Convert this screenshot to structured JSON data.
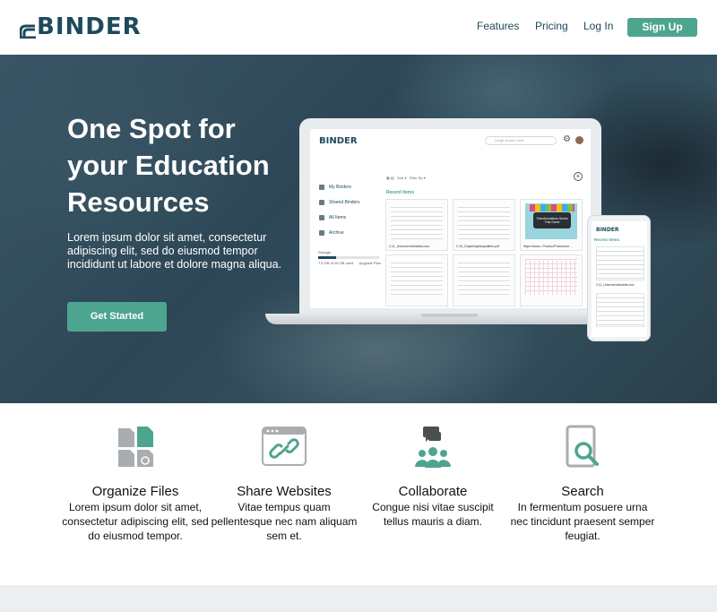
{
  "nav": {
    "logo_text": "BINDER",
    "links": [
      "Features",
      "Pricing",
      "Log In"
    ],
    "signup_label": "Sign Up"
  },
  "hero": {
    "title": "One Spot for your Education Resources",
    "text": "Lorem ipsum dolor sit amet, consectetur adipiscing elit, sed do eiusmod tempor incididunt ut labore et dolore magna aliqua.",
    "cta_label": "Get Started"
  },
  "app_preview": {
    "logo_text": "BINDER",
    "search_placeholder": "Large search here",
    "sidebar": [
      "My Binders",
      "Shared Binders",
      "All Items",
      "Archive"
    ],
    "storage_label": "Storage",
    "storage_fraction": 0.3,
    "storage_text": "7.5 GB of 25 GB used",
    "upgrade_label": "Upgrade Plan",
    "toolbar_sort": "Sort",
    "toolbar_filter": "Filter By",
    "recent_label": "Recent Items",
    "cards": [
      {
        "caption": "2.11_UnknownVariables.doc",
        "type": "doc"
      },
      {
        "caption": "2.15_GraphingInequalities.pdf",
        "type": "doc"
      },
      {
        "caption": "https://www...Product/Transform...",
        "type": "game"
      },
      {
        "caption": "",
        "type": "doc"
      },
      {
        "caption": "",
        "type": "doc"
      },
      {
        "caption": "",
        "type": "graph"
      }
    ],
    "game_caption": "Transformations Guess That Game"
  },
  "phone_preview": {
    "logo_text": "BINDER",
    "recent_label": "Recent Items",
    "caption": "2.11_UnknownVariables.doc"
  },
  "features": [
    {
      "icon": "files-icon",
      "title": "Organize Files",
      "text": "Lorem ipsum dolor sit amet, consectetur adipiscing elit, sed do eiusmod tempor."
    },
    {
      "icon": "link-window-icon",
      "title": "Share Websites",
      "text": "Vitae tempus quam pellentesque nec nam aliquam sem et."
    },
    {
      "icon": "people-chat-icon",
      "title": "Collaborate",
      "text": "Congue nisi vitae suscipit tellus mauris a diam."
    },
    {
      "icon": "search-document-icon",
      "title": "Search",
      "text": "In fermentum posuere urna nec tincidunt praesent semper feugiat."
    }
  ],
  "colors": {
    "accent": "#4ea58f",
    "brand_dark": "#1e4a5c",
    "hero_overlay": "#2d4756"
  }
}
